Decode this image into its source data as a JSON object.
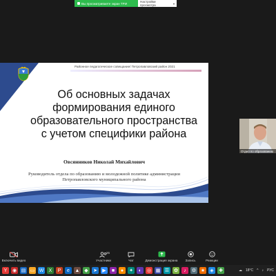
{
  "share_bar": {
    "status": "Вы просматриваете экран ТРИ",
    "settings": "Настройки просмотра"
  },
  "slide": {
    "caption": "Районное педагогическое совещание/ Петропавловский район 2021",
    "title": "Об основных задачах формирования единого образовательного пространства с учетом специфики района",
    "author": "Овсянников Николай Михайлович",
    "position": "Руководитель отдела по образованию и молодежной политике администрации Петропавловского муниципального района"
  },
  "speaker": {
    "name": "Отдел по образованию"
  },
  "toolbar": {
    "video_label": "Включить видео",
    "participants_label": "Участники",
    "participants_count": "26",
    "chat_label": "Чат",
    "share_label": "Демонстрация экрана",
    "record_label": "Запись",
    "reactions_label": "Реакции"
  },
  "taskbar": {
    "weather": "18°C",
    "lang": "РУС"
  },
  "colors": {
    "share_green": "#2dbb4d",
    "slide_blue": "#2d4b8e",
    "toolbar_bg": "#1a1a1a"
  }
}
